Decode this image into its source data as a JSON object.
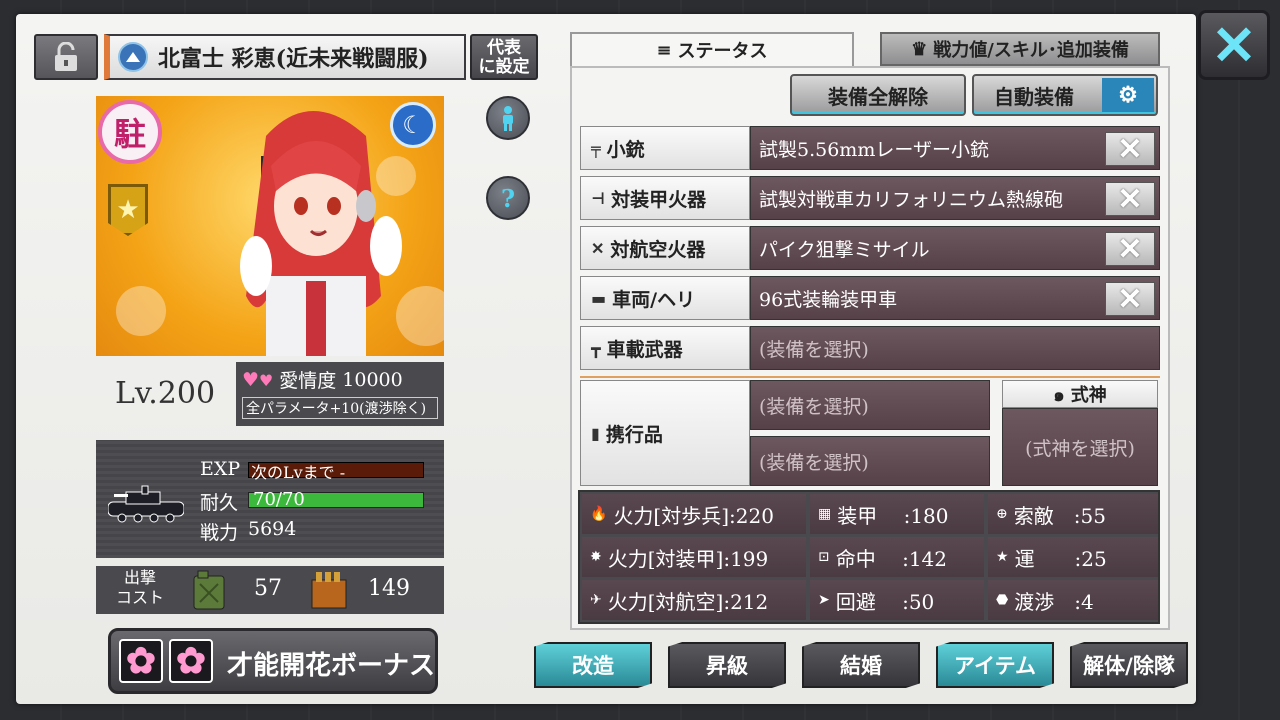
{
  "header": {
    "name": "北富士 彩恵(近未来戦闘服)",
    "rep_button": "代表\nに設定"
  },
  "portrait": {
    "station_badge": "駐"
  },
  "level": "Lv.200",
  "affection": {
    "label": "愛情度",
    "value": "10000",
    "bonus": "全パラメータ+10(渡渉除く)"
  },
  "stats": {
    "exp_label": "EXP",
    "exp_next": "次のLvまで -",
    "dur_label": "耐久",
    "dur_value": "70/70",
    "dur_fraction": 1.0,
    "power_label": "戦力",
    "power_value": "5694"
  },
  "cost": {
    "label": "出撃\nコスト",
    "fuel": "57",
    "ammo": "149"
  },
  "talent_button": "才能開花ボーナス",
  "tabs": [
    {
      "label": "ステータス"
    },
    {
      "label": "戦力値/スキル･追加装備"
    }
  ],
  "buttons": {
    "unequip_all": "装備全解除",
    "auto_equip": "自動装備"
  },
  "equipment": [
    {
      "slot": "小銃",
      "item": "試製5.56mmレーザー小銃",
      "icon": "rifle-icon"
    },
    {
      "slot": "対装甲火器",
      "item": "試製対戦車カリフォリニウム熱線砲",
      "icon": "antiarmor-icon"
    },
    {
      "slot": "対航空火器",
      "item": "パイク狙撃ミサイル",
      "icon": "antiair-icon"
    },
    {
      "slot": "車両/ヘリ",
      "item": "96式装輪装甲車",
      "icon": "vehicle-icon"
    },
    {
      "slot": "車載武器",
      "item": "(装備を選択)",
      "icon": "mounted-weapon-icon"
    }
  ],
  "carry": {
    "label": "携行品",
    "slot1": "(装備を選択)",
    "slot2": "(装備を選択)"
  },
  "shikigami": {
    "label": "式神",
    "slot": "(式神を選択)"
  },
  "params": [
    [
      "火力[対歩兵]:220",
      "装甲　 :180",
      "索敵　:55"
    ],
    [
      "火力[対装甲]:199",
      "命中　 :142",
      "運　　:25"
    ],
    [
      "火力[対航空]:212",
      "回避　 :50",
      "渡渉　:4"
    ]
  ],
  "bottom_buttons": [
    "改造",
    "昇級",
    "結婚",
    "アイテム",
    "解体/除隊"
  ]
}
